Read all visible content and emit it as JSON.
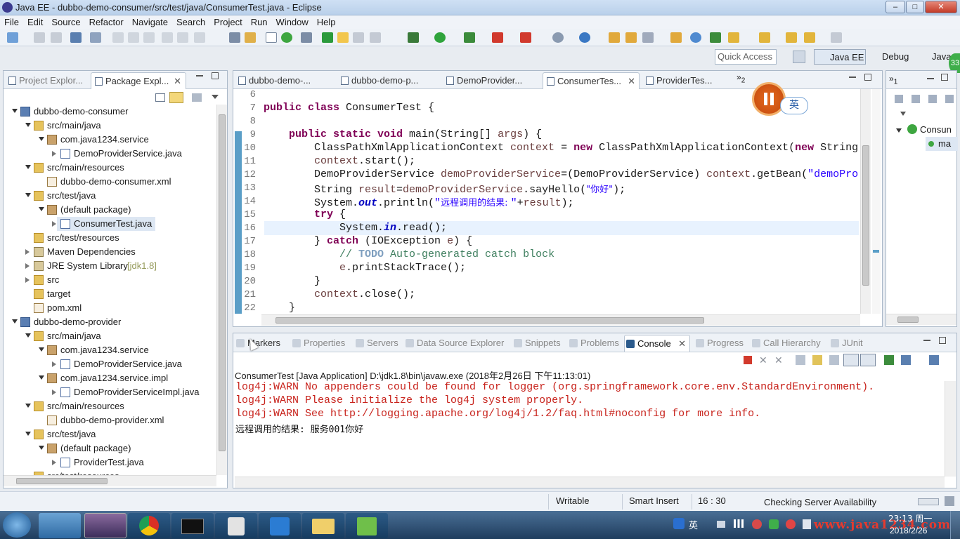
{
  "window": {
    "title": "Java EE - dubbo-demo-consumer/src/test/java/ConsumerTest.java - Eclipse"
  },
  "menu": [
    "File",
    "Edit",
    "Source",
    "Refactor",
    "Navigate",
    "Search",
    "Project",
    "Run",
    "Window",
    "Help"
  ],
  "quick_access": {
    "placeholder": "Quick Access"
  },
  "perspectives": [
    "Java EE",
    "Debug",
    "Java"
  ],
  "left_tabs": [
    {
      "label": "Project Explor..."
    },
    {
      "label": "Package Expl..."
    }
  ],
  "tree": [
    {
      "label": "dubbo-demo-consumer"
    },
    {
      "label": "src/main/java"
    },
    {
      "label": "com.java1234.service"
    },
    {
      "label": "DemoProviderService.java"
    },
    {
      "label": "src/main/resources"
    },
    {
      "label": "dubbo-demo-consumer.xml"
    },
    {
      "label": "src/test/java"
    },
    {
      "label": "(default package)"
    },
    {
      "label": "ConsumerTest.java"
    },
    {
      "label": "src/test/resources"
    },
    {
      "label": "Maven Dependencies"
    },
    {
      "label": "JRE System Library",
      "decor": "[jdk1.8]"
    },
    {
      "label": "src"
    },
    {
      "label": "target"
    },
    {
      "label": "pom.xml"
    },
    {
      "label": "dubbo-demo-provider"
    },
    {
      "label": "src/main/java"
    },
    {
      "label": "com.java1234.service"
    },
    {
      "label": "DemoProviderService.java"
    },
    {
      "label": "com.java1234.service.impl"
    },
    {
      "label": "DemoProviderServiceImpl.java"
    },
    {
      "label": "src/main/resources"
    },
    {
      "label": "dubbo-demo-provider.xml"
    },
    {
      "label": "src/test/java"
    },
    {
      "label": "(default package)"
    },
    {
      "label": "ProviderTest.java"
    },
    {
      "label": "src/test/resources"
    }
  ],
  "editor_tabs": [
    {
      "label": "dubbo-demo-..."
    },
    {
      "label": "dubbo-demo-p..."
    },
    {
      "label": "DemoProvider..."
    },
    {
      "label": "ConsumerTes..."
    },
    {
      "label": "ProviderTes..."
    }
  ],
  "editor_overflow": "2",
  "line_numbers": [
    "6",
    "7",
    "8",
    "9",
    "10",
    "11",
    "12",
    "13",
    "14",
    "15",
    "16",
    "17",
    "18",
    "19",
    "20",
    "21",
    "22"
  ],
  "code": {
    "l7_kw": "public class",
    "l7_rest": " ConsumerTest {",
    "l9_kw": "public static void",
    "l9_rest": " main(String[] ",
    "l9_var": "args",
    "l9_end": ") {",
    "l10_a": "ClassPathXmlApplicationContext ",
    "l10_var": "context",
    "l10_b": " = ",
    "l10_kw": "new",
    "l10_c": " ClassPathXmlApplicationContext(",
    "l10_kw2": "new",
    "l10_d": " String",
    "l11_var": "context",
    "l11_rest": ".start();",
    "l12_a": "DemoProviderService ",
    "l12_var": "demoProviderService",
    "l12_b": "=(DemoProviderService) ",
    "l12_var2": "context",
    "l12_c": ".getBean(",
    "l12_str": "\"demoPro",
    "l13_a": "String ",
    "l13_var": "result",
    "l13_b": "=",
    "l13_var2": "demoProviderService",
    "l13_c": ".sayHello(",
    "l13_str": "\"你好\"",
    "l13_d": ");",
    "l14_a": "System.",
    "l14_fld": "out",
    "l14_b": ".println(",
    "l14_str1": "\"",
    "l14_cjk": "远程调用的结果: ",
    "l14_str2": "\"",
    "l14_c": "+",
    "l14_var": "result",
    "l14_d": ");",
    "l15_kw": "try",
    "l15_rest": " {",
    "l16_a": "System.",
    "l16_fld": "in",
    "l16_b": ".read();",
    "l17_a": "} ",
    "l17_kw": "catch",
    "l17_b": " (IOException ",
    "l17_var": "e",
    "l17_c": ") {",
    "l18_cmt": "// ",
    "l18_todo": "TODO",
    "l18_rest": " Auto-generated catch block",
    "l19_var": "e",
    "l19_rest": ".printStackTrace();",
    "l20": "}",
    "l21_var": "context",
    "l21_rest": ".close();",
    "l22": "}"
  },
  "overlay": {
    "ime_label": "英"
  },
  "outline": {
    "label1": "Consun",
    "label2": "ma",
    "num_a": "1",
    "num_b": "1"
  },
  "bottom_tabs": [
    "Markers",
    "Properties",
    "Servers",
    "Data Source Explorer",
    "Snippets",
    "Problems",
    "Console",
    "Progress",
    "Call Hierarchy",
    "JUnit"
  ],
  "console": {
    "header": "ConsumerTest [Java Application] D:\\jdk1.8\\bin\\javaw.exe (2018年2月26日 下午11:13:01)",
    "lines": [
      "log4j:WARN No appenders could be found for logger (org.springframework.core.env.StandardEnvironment).",
      "log4j:WARN Please initialize the log4j system properly.",
      "log4j:WARN See http://logging.apache.org/log4j/1.2/faq.html#noconfig for more info.",
      "远程调用的结果: 服务001你好"
    ]
  },
  "status": {
    "writable": "Writable",
    "insert": "Smart Insert",
    "position": "16 : 30",
    "task": "Checking Server Availability"
  },
  "taskbar": {
    "ime": "英",
    "time": "23:13 周一",
    "date": "2018/2/26",
    "watermark": "www.java1234.com"
  },
  "badge": "33",
  "colors": {
    "warn": "#c8231c",
    "keyword": "#7f0055",
    "string": "#2a00ff",
    "comment": "#3f7f5f"
  }
}
